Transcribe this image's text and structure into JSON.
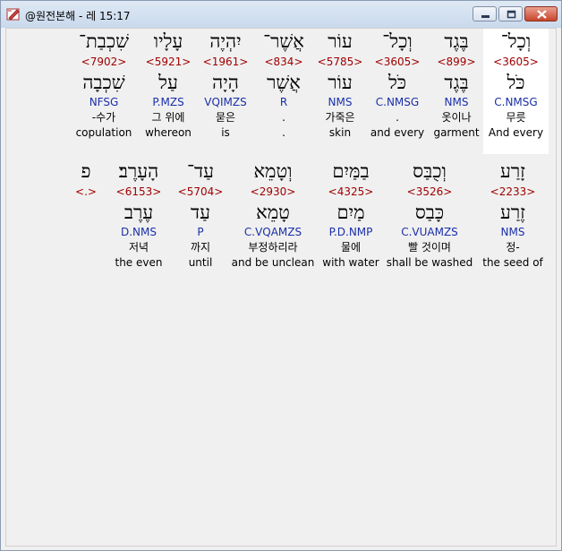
{
  "window": {
    "title": "@원전본해 - 레 15:17",
    "icon": "app-edit-icon"
  },
  "row1": [
    {
      "heb": "וְכָל־",
      "strong": "<3605>",
      "lemma": "כֹּל",
      "morph": "C.NMSG",
      "kor": "무릇",
      "eng": "And every",
      "selected": true
    },
    {
      "heb": "בֶּגֶד",
      "strong": "<899>",
      "lemma": "בֶּגֶד",
      "morph": "NMS",
      "kor": "옷이나",
      "eng": "garment"
    },
    {
      "heb": "וְכָל־",
      "strong": "<3605>",
      "lemma": "כֹּל",
      "morph": "C.NMSG",
      "kor": ".",
      "eng": "and every"
    },
    {
      "heb": "עוֹר",
      "strong": "<5785>",
      "lemma": "עוֹר",
      "morph": "NMS",
      "kor": "가죽은",
      "eng": "skin"
    },
    {
      "heb": "אֲשֶׁר־",
      "strong": "<834>",
      "lemma": "אֲשֶׁר",
      "morph": "R",
      "kor": ".",
      "eng": "."
    },
    {
      "heb": "יִהְיֶה",
      "strong": "<1961>",
      "lemma": "הָיָה",
      "morph": "VQIMZS",
      "kor": "묻은",
      "eng": "is"
    },
    {
      "heb": "עָלָיו",
      "strong": "<5921>",
      "lemma": "עַל",
      "morph": "P.MZS",
      "kor": "그 위에",
      "eng": "whereon"
    },
    {
      "heb": "שִׁכְבַת־",
      "strong": "<7902>",
      "lemma": "שִׁכְבָה",
      "morph": "NFSG",
      "kor": "-수가",
      "eng": "copulation"
    }
  ],
  "row2": [
    {
      "heb": "זָרַע",
      "strong": "<2233>",
      "lemma": "זֶרַע",
      "morph": "NMS",
      "kor": "정-",
      "eng": "the seed of"
    },
    {
      "heb": "וְכֻבַּס",
      "strong": "<3526>",
      "lemma": "כָּבַס",
      "morph": "C.VUAMZS",
      "kor": "빨 것이며",
      "eng": "shall be washed"
    },
    {
      "heb": "בַמַּיִם",
      "strong": "<4325>",
      "lemma": "מַיִם",
      "morph": "P.D.NMP",
      "kor": "물에",
      "eng": "with water"
    },
    {
      "heb": "וְטָמֵא",
      "strong": "<2930>",
      "lemma": "טָמֵא",
      "morph": "C.VQAMZS",
      "kor": "부정하리라",
      "eng": "and be unclean"
    },
    {
      "heb": "עַד־",
      "strong": "<5704>",
      "lemma": "עַד",
      "morph": "P",
      "kor": "까지",
      "eng": "until"
    },
    {
      "heb": "הָעָרֶב׃",
      "strong": "<6153>",
      "lemma": "עֶרֶב",
      "morph": "D.NMS",
      "kor": "저녁",
      "eng": "the even"
    },
    {
      "heb": "פ",
      "strong": "<.>",
      "lemma": "",
      "morph": "",
      "kor": "",
      "eng": ""
    }
  ]
}
